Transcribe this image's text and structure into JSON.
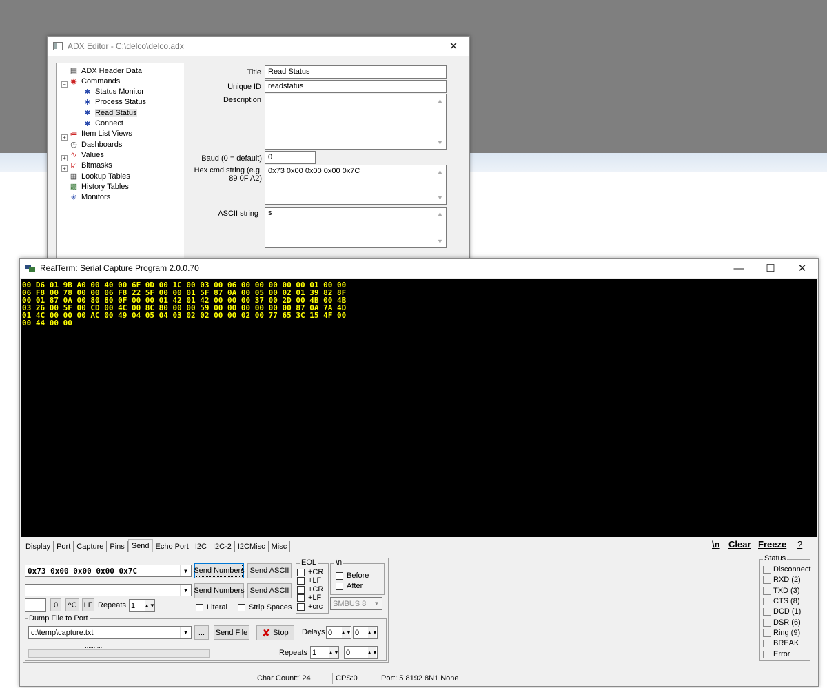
{
  "adx": {
    "title": "ADX Editor - C:\\delco\\delco.adx",
    "tree": [
      {
        "label": "ADX Header Data",
        "icon": "header-data-icon",
        "glyph": "▤"
      },
      {
        "label": "Commands",
        "icon": "commands-icon",
        "glyph": "◉"
      },
      {
        "label": "Status Monitor",
        "icon": "command-icon",
        "glyph": "✱"
      },
      {
        "label": "Process Status",
        "icon": "command-icon",
        "glyph": "✱"
      },
      {
        "label": "Read Status",
        "icon": "command-icon",
        "glyph": "✱"
      },
      {
        "label": "Connect",
        "icon": "command-icon",
        "glyph": "✱"
      },
      {
        "label": "Item List Views",
        "icon": "list-views-icon",
        "glyph": "≔"
      },
      {
        "label": "Dashboards",
        "icon": "dashboard-icon",
        "glyph": "◷"
      },
      {
        "label": "Values",
        "icon": "values-icon",
        "glyph": "∿"
      },
      {
        "label": "Bitmasks",
        "icon": "bitmask-icon",
        "glyph": "☑"
      },
      {
        "label": "Lookup Tables",
        "icon": "lookup-table-icon",
        "glyph": "▦"
      },
      {
        "label": "History Tables",
        "icon": "history-table-icon",
        "glyph": "▩"
      },
      {
        "label": "Monitors",
        "icon": "monitor-icon",
        "glyph": "✳"
      }
    ],
    "labels": {
      "title": "Title",
      "unique_id": "Unique ID",
      "description": "Description",
      "baud": "Baud (0 = default)",
      "hex_line1": "Hex cmd string (e.g.",
      "hex_line2": "89 0F A2)",
      "ascii": "ASCII string"
    },
    "values": {
      "title": "Read Status",
      "unique_id": "readstatus",
      "description": "",
      "baud": "0",
      "hex": "0x73 0x00 0x00 0x00 0x7C",
      "ascii": "s"
    }
  },
  "realterm": {
    "title": "RealTerm: Serial Capture Program 2.0.0.70",
    "terminal_lines": [
      "00 D6 01 9B A0 00 40 00 6F 0D 00 1C 00 03 00 06 00 00 00 00 00 01 00 00",
      "06 F8 00 78 00 00 06 F8 22 5F 00 00 01 5F 87 0A 00 05 00 02 01 39 82 8F",
      "00 01 87 0A 00 80 80 0F 00 00 01 42 01 42 00 00 00 37 00 2D 00 4B 00 4B",
      "03 26 00 5F 00 CD 00 4C 00 8C 80 00 00 59 00 00 00 00 00 00 87 0A 7A 4D",
      "01 4C 00 00 00 AC 00 49 04 05 04 03 02 02 00 00 02 00 77 65 3C 15 4F 00",
      "00 44 00 00"
    ],
    "tabs": [
      "Display",
      "Port",
      "Capture",
      "Pins",
      "Send",
      "Echo Port",
      "I2C",
      "I2C-2",
      "I2CMisc",
      "Misc"
    ],
    "active_tab": "Send",
    "toolbar": {
      "newline": "\\n",
      "clear": "Clear",
      "freeze": "Freeze",
      "help": "?"
    },
    "send": {
      "number_input1": "0x73 0x00 0x00 0x00 0x7C",
      "number_input2": "",
      "send_numbers": "Send Numbers",
      "send_ascii": "Send ASCII",
      "char_input": "",
      "btn_zero": "0",
      "btn_ctrl_c": "^C",
      "btn_lf": "LF",
      "repeats_label": "Repeats",
      "repeats_value": "1",
      "literal": "Literal",
      "strip_spaces": "Strip Spaces",
      "eol_title": "EOL",
      "eol_cr1": "+CR",
      "eol_lf1": "+LF",
      "eol_cr2": "+CR",
      "eol_lf2": "+LF",
      "eol_crc": "+crc",
      "nl_title": "\\n",
      "before": "Before",
      "after": "After",
      "smbus": "SMBUS 8"
    },
    "dump": {
      "title": "Dump File to Port",
      "file": "c:\\temp\\capture.txt",
      "browse": "...",
      "send_file": "Send File",
      "stop": "Stop",
      "delays_label": "Delays",
      "delay1": "0",
      "delay2": "0",
      "repeats_label": "Repeats",
      "repeats1": "1",
      "repeats2": "0",
      "progress_text": "..........."
    },
    "status": {
      "title": "Status",
      "items": [
        "Disconnect",
        "RXD (2)",
        "TXD (3)",
        "CTS (8)",
        "DCD (1)",
        "DSR (6)",
        "Ring (9)",
        "BREAK",
        "Error"
      ]
    },
    "statusbar": {
      "char_count": "Char Count:124",
      "cps": "CPS:0",
      "port": "Port: 5 8192 8N1 None"
    },
    "colors": {
      "terminal_bg": "#000000",
      "terminal_fg": "#ffff00"
    }
  }
}
